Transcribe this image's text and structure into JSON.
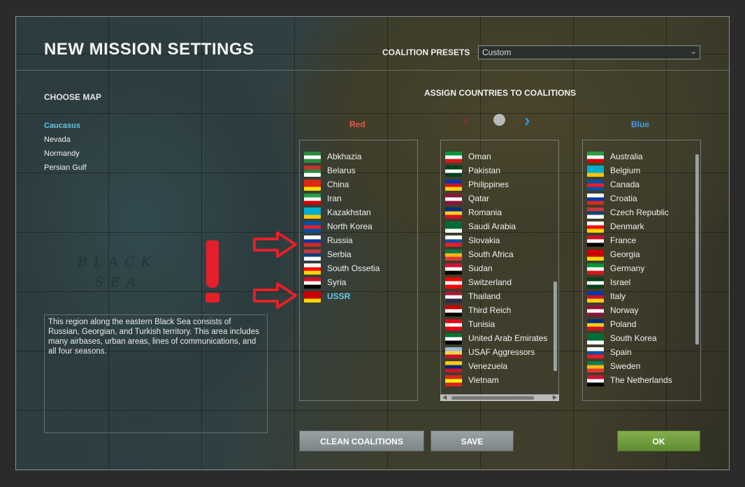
{
  "header": {
    "title": "NEW MISSION SETTINGS",
    "coalition_presets_label": "COALITION PRESETS",
    "coalition_presets_value": "Custom"
  },
  "map_section": {
    "label": "CHOOSE MAP",
    "maps": [
      "Caucasus",
      "Nevada",
      "Normandy",
      "Persian Gulf"
    ],
    "selected": "Caucasus",
    "description": "This region along the eastern Black Sea consists of Russian, Georgian, and Turkish territory. This area includes many airbases, urban areas, lines of communications, and all four seasons."
  },
  "map_labels": {
    "sea_line1": "BLACK",
    "sea_line2": "SEA"
  },
  "coalitions": {
    "heading": "ASSIGN COUNTRIES TO COALITIONS",
    "red_label": "Red",
    "blue_label": "Blue",
    "red_countries": [
      "Abkhazia",
      "Belarus",
      "China",
      "Iran",
      "Kazakhstan",
      "North Korea",
      "Russia",
      "Serbia",
      "South Ossetia",
      "Syria",
      "USSR"
    ],
    "red_selected": "USSR",
    "neutral_countries": [
      "Oman",
      "Pakistan",
      "Philippines",
      "Qatar",
      "Romania",
      "Saudi Arabia",
      "Slovakia",
      "South Africa",
      "Sudan",
      "Switzerland",
      "Thailand",
      "Third Reich",
      "Tunisia",
      "United Arab Emirates",
      "USAF Aggressors",
      "Venezuela",
      "Vietnam"
    ],
    "blue_countries": [
      "Australia",
      "Belgium",
      "Canada",
      "Croatia",
      "Czech Republic",
      "Denmark",
      "France",
      "Georgia",
      "Germany",
      "Israel",
      "Italy",
      "Norway",
      "Poland",
      "South Korea",
      "Spain",
      "Sweden",
      "The Netherlands"
    ]
  },
  "buttons": {
    "clean": "CLEAN COALITIONS",
    "save": "SAVE",
    "ok": "OK"
  },
  "colors": {
    "accent_selected": "#63c8ea",
    "red_coalition": "#e85a4a",
    "blue_coalition": "#4a9ae8",
    "ok_button": "#6f9a3f",
    "annotation_red": "#e4202a"
  },
  "icons": {
    "arrow_left": "red-chevron-left-icon",
    "center": "neutral-dot-icon",
    "arrow_right": "blue-chevron-right-icon",
    "annotation": "red-exclamation-icon",
    "annotation_arrows": "red-outline-arrow-icon"
  }
}
